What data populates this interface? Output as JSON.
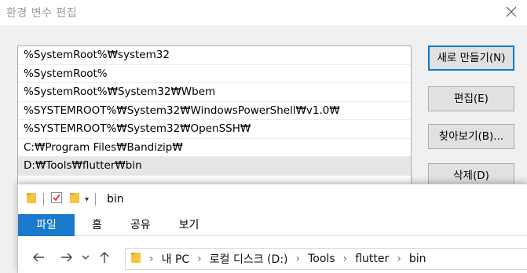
{
  "dialog": {
    "title": "환경 변수 편집",
    "paths": [
      "%SystemRoot%₩system32",
      "%SystemRoot%",
      "%SystemRoot%₩System32₩Wbem",
      "%SYSTEMROOT%₩System32₩WindowsPowerShell₩v1.0₩",
      "%SYSTEMROOT%₩System32₩OpenSSH₩",
      "C:₩Program Files₩Bandizip₩",
      "D:₩Tools₩flutter₩bin"
    ],
    "selected_index": 6,
    "buttons": {
      "new": "새로 만들기(N)",
      "edit": "편집(E)",
      "browse": "찾아보기(B)...",
      "delete": "삭제(D)"
    }
  },
  "explorer": {
    "title": "bin",
    "tabs": [
      "파일",
      "홈",
      "공유",
      "보기"
    ],
    "breadcrumb": [
      "내 PC",
      "로컬 디스크 (D:)",
      "Tools",
      "flutter",
      "bin"
    ]
  },
  "colors": {
    "file_tab": "#1979ca",
    "focus_border": "#0078d7",
    "folder": "#f5c542"
  }
}
